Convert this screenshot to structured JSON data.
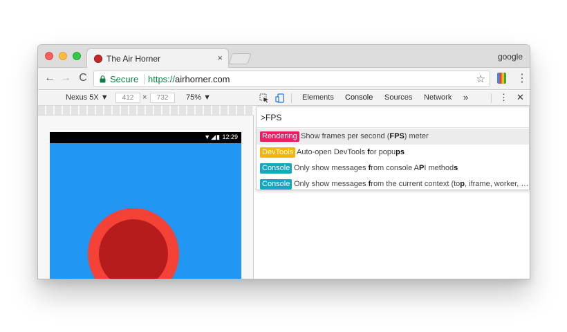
{
  "colors": {
    "rendering": "#e91e63",
    "devtools": "#f4b400",
    "console": "#12a8c1",
    "secure": "#0b8043",
    "phone_bg": "#2196f3",
    "horn_outer": "#f44336",
    "horn_inner": "#b71c1c"
  },
  "browser": {
    "tab_title": "The Air Horner",
    "tab_close": "×",
    "profile": "google",
    "secure_label": "Secure",
    "url_scheme": "https://",
    "url_host": "airhorner.com",
    "back_icon": "←",
    "forward_icon": "→",
    "reload_icon": "C",
    "star_icon": "☆",
    "menu_icon": "⋮"
  },
  "emulation": {
    "device": "Nexus 5X ▼",
    "width": "412",
    "times": "×",
    "height": "732",
    "zoom": "75% ▼",
    "status_icons": "▼◢▮",
    "status_time": "12:29"
  },
  "devtools": {
    "tabs": [
      "Elements",
      "Console",
      "Sources",
      "Network"
    ],
    "more": "»",
    "dots": "⋮",
    "close": "✕",
    "command_input": ">FPS",
    "results": [
      {
        "badge": "Rendering",
        "pre": "Show frames per second (",
        "bold": "FPS",
        "post": ") meter"
      },
      {
        "badge": "DevTools",
        "pre": "Auto-open DevTools ",
        "bold": "f",
        "post": "or popu",
        "bold2": "ps",
        "post2": ""
      },
      {
        "badge": "Console",
        "pre": "Only show messages ",
        "bold": "f",
        "post": "rom console A",
        "bold2": "P",
        "post2": "I method",
        "bold3": "s"
      },
      {
        "badge": "Console",
        "pre": "Only show messages ",
        "bold": "f",
        "post": "rom the current context (to",
        "bold2": "p",
        "post2": ", iframe, worker, …"
      }
    ]
  }
}
